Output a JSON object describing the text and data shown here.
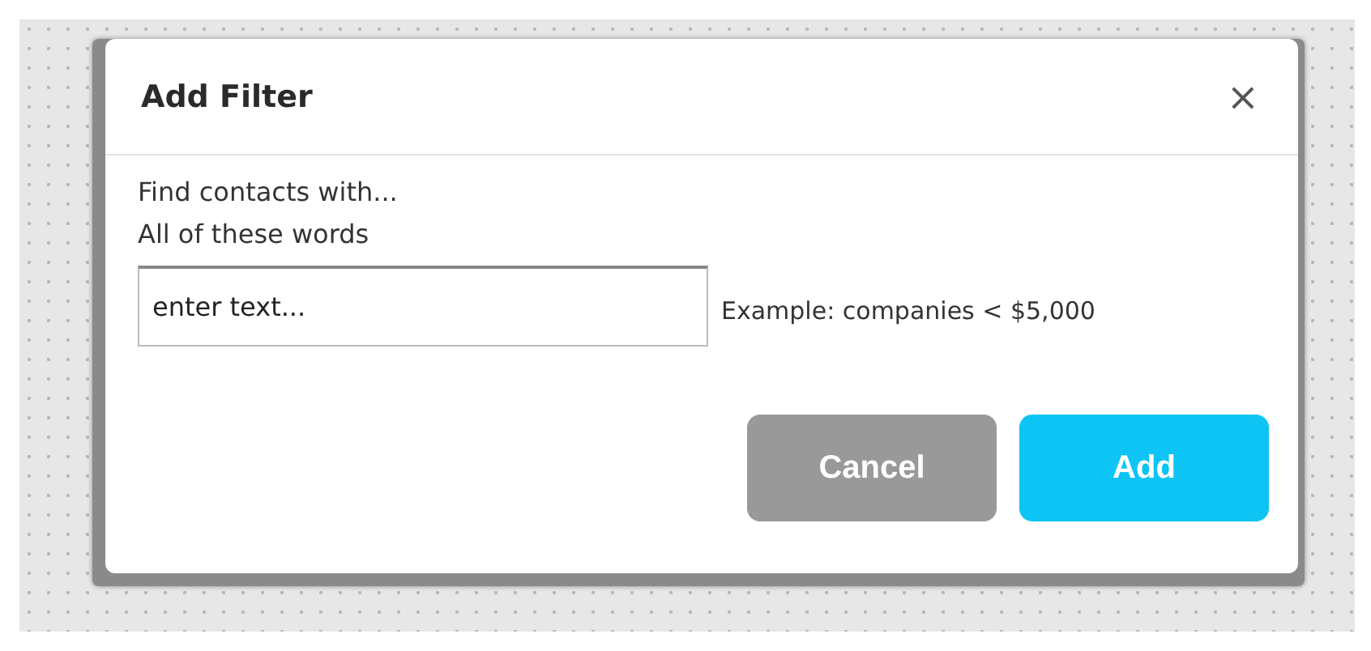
{
  "dialog": {
    "title": "Add Filter",
    "close": "×",
    "intro": "Find contacts with...",
    "field_label": "All of these words",
    "field": {
      "value": "enter text..."
    },
    "example": "Example: companies < $5,000",
    "buttons": [
      {
        "label": "Cancel",
        "kind": "secondary"
      },
      {
        "label": "Add",
        "kind": "primary"
      }
    ]
  }
}
